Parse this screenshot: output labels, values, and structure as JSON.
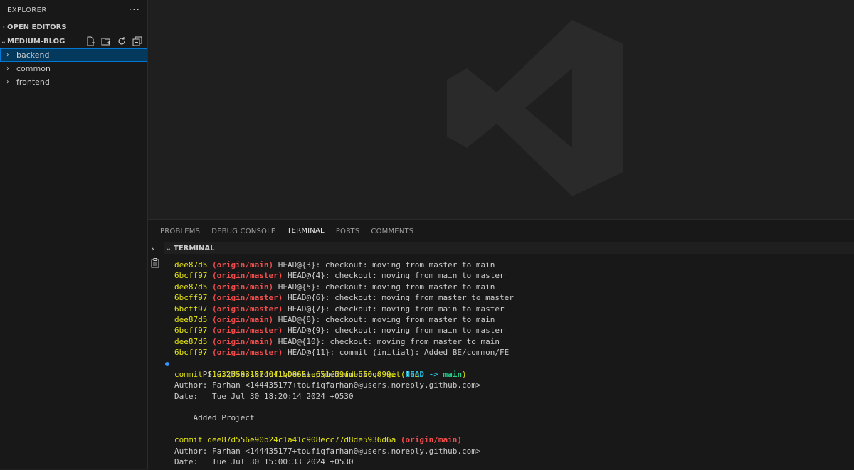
{
  "sidebar": {
    "title": "EXPLORER",
    "more": "···",
    "open_editors": "OPEN EDITORS",
    "project": "MEDIUM-BLOG",
    "items": [
      {
        "label": "backend"
      },
      {
        "label": "common"
      },
      {
        "label": "frontend"
      }
    ]
  },
  "panel": {
    "tabs": [
      "PROBLEMS",
      "DEBUG CONSOLE",
      "TERMINAL",
      "PORTS",
      "COMMENTS"
    ],
    "active_tab": "TERMINAL",
    "terminal_header": "TERMINAL"
  },
  "terminal": {
    "reflog": [
      {
        "hash": "dee87d5",
        "ref": "(origin/main)",
        "rest": " HEAD@{3}: checkout: moving from master to main"
      },
      {
        "hash": "6bcff97",
        "ref": "(origin/master)",
        "rest": " HEAD@{4}: checkout: moving from main to master"
      },
      {
        "hash": "dee87d5",
        "ref": "(origin/main)",
        "rest": " HEAD@{5}: checkout: moving from master to main"
      },
      {
        "hash": "6bcff97",
        "ref": "(origin/master)",
        "rest": " HEAD@{6}: checkout: moving from master to master"
      },
      {
        "hash": "6bcff97",
        "ref": "(origin/master)",
        "rest": " HEAD@{7}: checkout: moving from main to master"
      },
      {
        "hash": "dee87d5",
        "ref": "(origin/main)",
        "rest": " HEAD@{8}: checkout: moving from master to main"
      },
      {
        "hash": "6bcff97",
        "ref": "(origin/master)",
        "rest": " HEAD@{9}: checkout: moving from main to master"
      },
      {
        "hash": "dee87d5",
        "ref": "(origin/main)",
        "rest": " HEAD@{10}: checkout: moving from master to main"
      },
      {
        "hash": "6bcff97",
        "ref": "(origin/master)",
        "rest": " HEAD@{11}: commit (initial): Added BE/common/FE"
      }
    ],
    "prompt": "PS C:\\Users\\toufi\\Desktop\\medium-blog> ",
    "command": "git log",
    "commit1": {
      "commit_prefix": "commit f1a3235831874041b0865ae651f59fdb550c099e ",
      "paren_open": "(",
      "head": "HEAD -> ",
      "branch": "main",
      "paren_close": ")",
      "author": "Author: Farhan <144435177+toufiqfarhan0@users.noreply.github.com>",
      "date": "Date:   Tue Jul 30 18:20:14 2024 +0530",
      "message": "    Added Project"
    },
    "commit2": {
      "commit_prefix": "commit dee87d556e90b24c1a41c908ecc77d8de5936d6a ",
      "ref": "(origin/main)",
      "author": "Author: Farhan <144435177+toufiqfarhan0@users.noreply.github.com>",
      "date": "Date:   Tue Jul 30 15:00:33 2024 +0530"
    }
  }
}
